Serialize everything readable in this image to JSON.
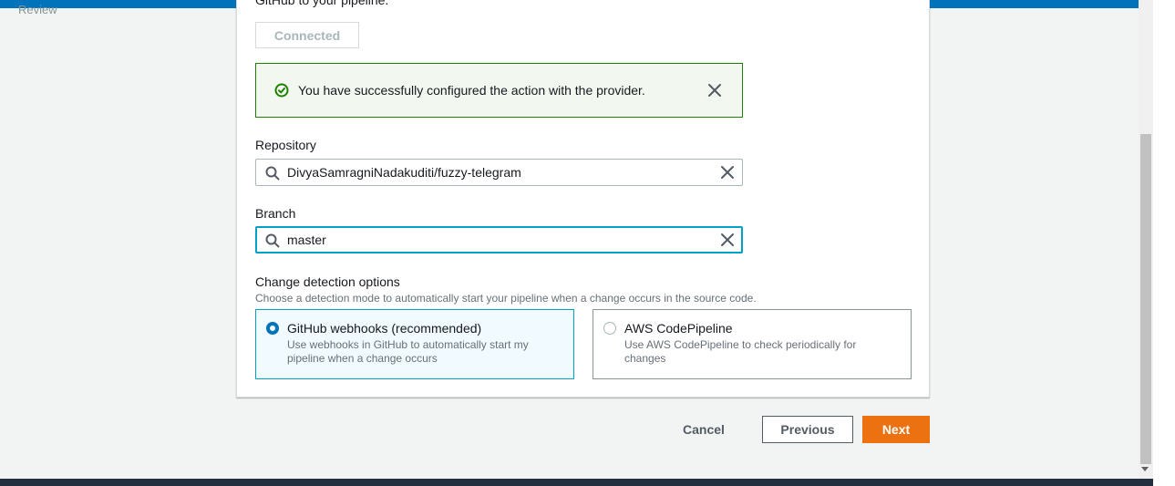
{
  "nav": {
    "review_label": "Review"
  },
  "source": {
    "cut_text": "GitHub to your pipeline.",
    "connected_label": "Connected",
    "alert": {
      "message": "You have successfully configured the action with the provider."
    },
    "repository": {
      "label": "Repository",
      "value": "DivyaSamragniNadakuditi/fuzzy-telegram"
    },
    "branch": {
      "label": "Branch",
      "value": "master"
    },
    "change_detection": {
      "title": "Change detection options",
      "description": "Choose a detection mode to automatically start your pipeline when a change occurs in the source code.",
      "options": [
        {
          "title": "GitHub webhooks (recommended)",
          "description": "Use webhooks in GitHub to automatically start my pipeline when a change occurs",
          "selected": true
        },
        {
          "title": "AWS CodePipeline",
          "description": "Use AWS CodePipeline to check periodically for changes",
          "selected": false
        }
      ]
    }
  },
  "footer": {
    "cancel_label": "Cancel",
    "previous_label": "Previous",
    "next_label": "Next"
  },
  "colors": {
    "primary": "#ec7211",
    "success": "#1d8102",
    "focus": "#00a1c9",
    "selected_radio": "#0073bb",
    "top_bar": "#0073bb"
  }
}
